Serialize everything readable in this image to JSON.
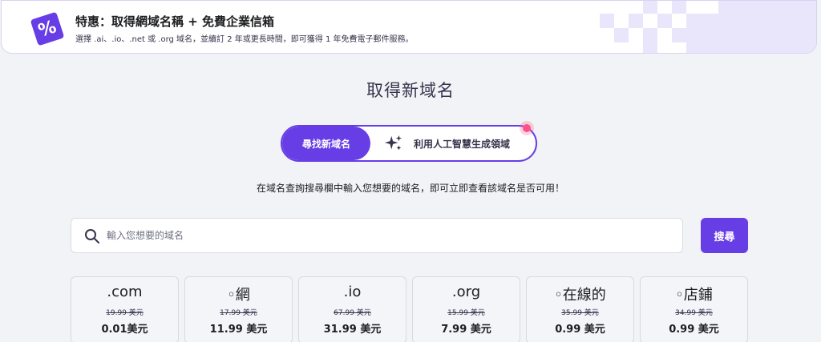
{
  "promo": {
    "icon": "percent-tag-icon",
    "icon_glyph": "%",
    "title": "特惠：取得網域名稱 + 免費企業信箱",
    "description": "選擇 .ai、.io、.net 或 .org 域名，並續訂 2 年或更長時間，即可獲得 1 年免費電子郵件服務。"
  },
  "page": {
    "title": "取得新域名",
    "subtitle": "在域名查詢搜尋欄中輸入您想要的域名，即可立即查看該域名是否可用！"
  },
  "toggle": {
    "find_label": "尋找新域名",
    "ai_label": "利用人工智慧生成領域"
  },
  "search": {
    "placeholder": "輸入您想要的域名",
    "value": "",
    "button_label": "搜尋"
  },
  "tlds": [
    {
      "name": ".com",
      "old_price": "19.99 美元",
      "price": "0.01美元"
    },
    {
      "name": "◦網",
      "old_price": "17.99 美元",
      "price": "11.99 美元"
    },
    {
      "name": ".io",
      "old_price": "67.99 美元",
      "price": "31.99 美元"
    },
    {
      "name": ".org",
      "old_price": "15.99 美元",
      "price": "7.99 美元"
    },
    {
      "name": "◦在線的",
      "old_price": "35.99 美元",
      "price": "0.99 美元"
    },
    {
      "name": "◦店鋪",
      "old_price": "34.99 美元",
      "price": "0.99 美元"
    }
  ],
  "colors": {
    "accent": "#673de6",
    "background": "#f2f3f6",
    "notification": "#fc5185"
  }
}
